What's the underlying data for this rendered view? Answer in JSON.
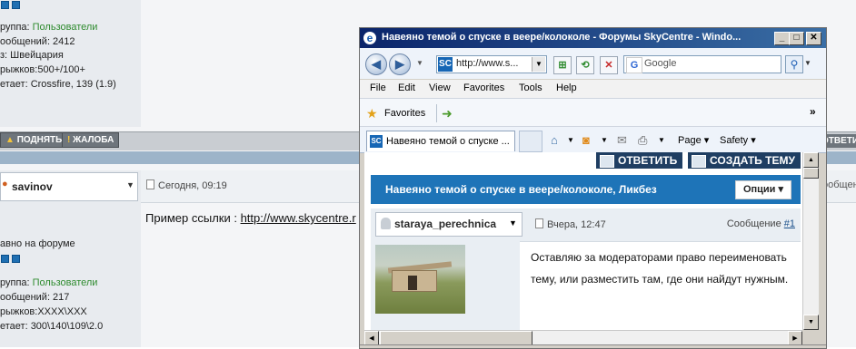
{
  "background": {
    "profile1": {
      "group": "руппа: ",
      "group_value": "Пользователи",
      "posts": "ообщений: 2412",
      "location": "з: Швейцария",
      "jumps": "рыжков:500+/100+",
      "flies": "етает: Crossfire, 139 (1.9)"
    },
    "actions": {
      "raise": "ПОДНЯТЬ",
      "complaint": "ЖАЛОБА",
      "reply_edge": "ОТВЕТИ"
    },
    "post2": {
      "username": "savinov",
      "date": "Сегодня, 09:19",
      "text_prefix": "Пример ссылки : ",
      "text_link": "http://www.skycentre.r",
      "status": "авно на форуме",
      "group": "руппа: ",
      "group_value": "Пользователи",
      "posts": "ообщений: 217",
      "jumps": "рыжков:XXXX\\XXX",
      "flies": "етает: 300\\140\\109\\2.0",
      "msg_edge": "ообщение"
    }
  },
  "ie": {
    "title": "Навеяно темой о спуске в веере/колоколе - Форумы SkyCentre - Windo...",
    "address": "http://www.s...",
    "search_placeholder": "Google",
    "menu": [
      "File",
      "Edit",
      "View",
      "Favorites",
      "Tools",
      "Help"
    ],
    "favorites_label": "Favorites",
    "tab_title": "Навеяно темой о спуске ...",
    "commands": {
      "page": "Page ▾",
      "safety": "Safety ▾"
    },
    "content": {
      "reply_btn": "ОТВЕТИТЬ",
      "create_btn": "СОЗДАТЬ ТЕМУ",
      "thread_title": "Навеяно темой о спуске в веере/колоколе, Ликбез",
      "options_btn": "Опции ▾",
      "post_user": "staraya_perechnica",
      "post_date": "Вчера, 12:47",
      "post_num_label": "Сообщение ",
      "post_num": "#1",
      "post_text": "Оставляю за модераторами право переименовать тему, или разместить там, где они найдут нужным."
    }
  },
  "colors": {
    "ie_titlebar": "#0a246a",
    "forum_header": "#1e74b8",
    "forum_dark_btn": "#1f3e62",
    "group_green": "#2e8b2e"
  },
  "icons": [
    "back-icon",
    "forward-icon",
    "refresh-icon",
    "stop-icon",
    "search-go-icon",
    "favorites-star-icon",
    "add-favorite-icon",
    "home-icon",
    "rss-icon",
    "mail-icon",
    "print-icon"
  ]
}
